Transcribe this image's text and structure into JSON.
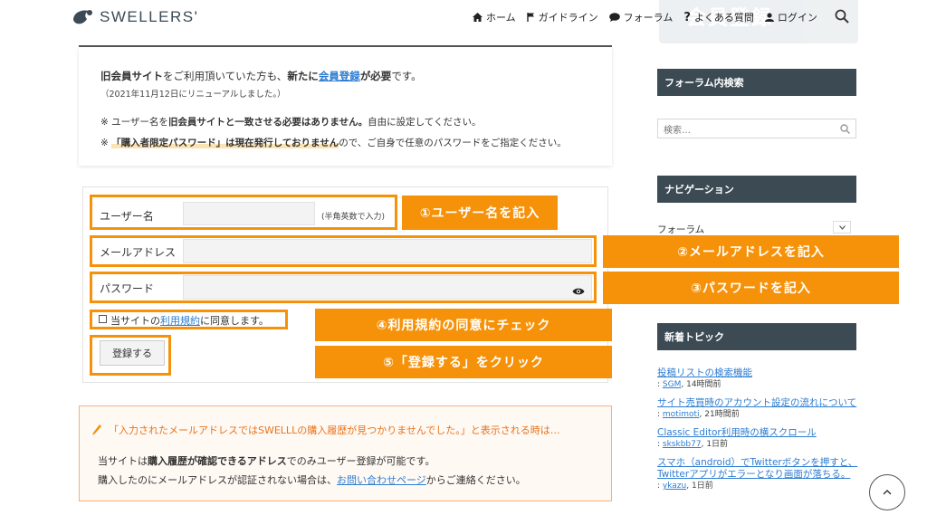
{
  "header": {
    "logo_text": "SWELLERS'",
    "banner_text": "会員登録",
    "nav": [
      {
        "icon": "home-icon",
        "label": "ホーム"
      },
      {
        "icon": "flag-icon",
        "label": "ガイドライン"
      },
      {
        "icon": "chat-bubble-icon",
        "label": "フォーラム"
      },
      {
        "icon": "question-icon",
        "label": "よくある質問"
      },
      {
        "icon": "user-icon",
        "label": "ログイン"
      }
    ]
  },
  "notice": {
    "line1_bold_a": "旧会員サイト",
    "line1_text_a": "をご利用頂いていた方も、",
    "line1_bold_b": "新たに",
    "line1_link": "会員登録",
    "line1_text_b": "が必要",
    "line1_end": "です。",
    "line2": "（2021年11月12日にリニューアルしました。）",
    "line3_pre": "※ ユーザー名を",
    "line3_bold": "旧会員サイトと一致させる必要はありません。",
    "line3_post": "自由に設定してください。",
    "line4_pre": "※ ",
    "line4_hl": "「購入者限定パスワード」は現在発行しておりません",
    "line4_post": "ので、ご自身で任意のパスワードをご指定ください。"
  },
  "form": {
    "username_label": "ユーザー名",
    "username_hint": "(半角英数で入力)",
    "username_value": "",
    "email_label": "メールアドレス",
    "email_value": "",
    "password_label": "パスワード",
    "password_value": "",
    "agree_pre": "当サイトの",
    "agree_link": "利用規約",
    "agree_post": "に同意します。",
    "agree_checked": false,
    "submit_label": "登録する"
  },
  "callouts": {
    "c1": "①ユーザー名を記入",
    "c2": "②メールアドレスを記入",
    "c3": "③パスワードを記入",
    "c4": "④利用規約の同意にチェック",
    "c5": "⑤「登録する」をクリック"
  },
  "alert": {
    "title": "「入力されたメールアドレスではSWELLLの購入履歴が見つかりませんでした。」と表示される時は…",
    "body1_pre": "当サイトは",
    "body1_bold": "購入履歴が確認できるアドレス",
    "body1_post": "でのみユーザー登録が可能です。",
    "body2_pre": "購入したのにメールアドレスが認証されない場合は、",
    "body2_link": "お問い合わせページ",
    "body2_post": "からご連絡ください。"
  },
  "sidebar": {
    "search_title": "フォーラム内検索",
    "search_placeholder": "検索…",
    "nav_title": "ナビゲーション",
    "nav_selected": "フォーラム",
    "topics_title": "新着トピック",
    "topics": [
      {
        "title": "投稿リストの検索機能",
        "user": "SGM",
        "time": "14時間前"
      },
      {
        "title": "サイト売買時のアカウント設定の流れについて",
        "user": "motimoti",
        "time": "21時間前"
      },
      {
        "title": "Classic Editor利用時の横スクロール",
        "user": "skskbb77",
        "time": "1日前"
      },
      {
        "title": "スマホ（android）でTwitterボタンを押すと、Twitterアプリがエラーとなり画面が落ちる。",
        "user": "ykazu",
        "time": "1日前"
      }
    ]
  },
  "colors": {
    "accent_orange": "#f6920a",
    "sidebar_header": "#3c4a53",
    "link_blue": "#2e7dd1"
  }
}
